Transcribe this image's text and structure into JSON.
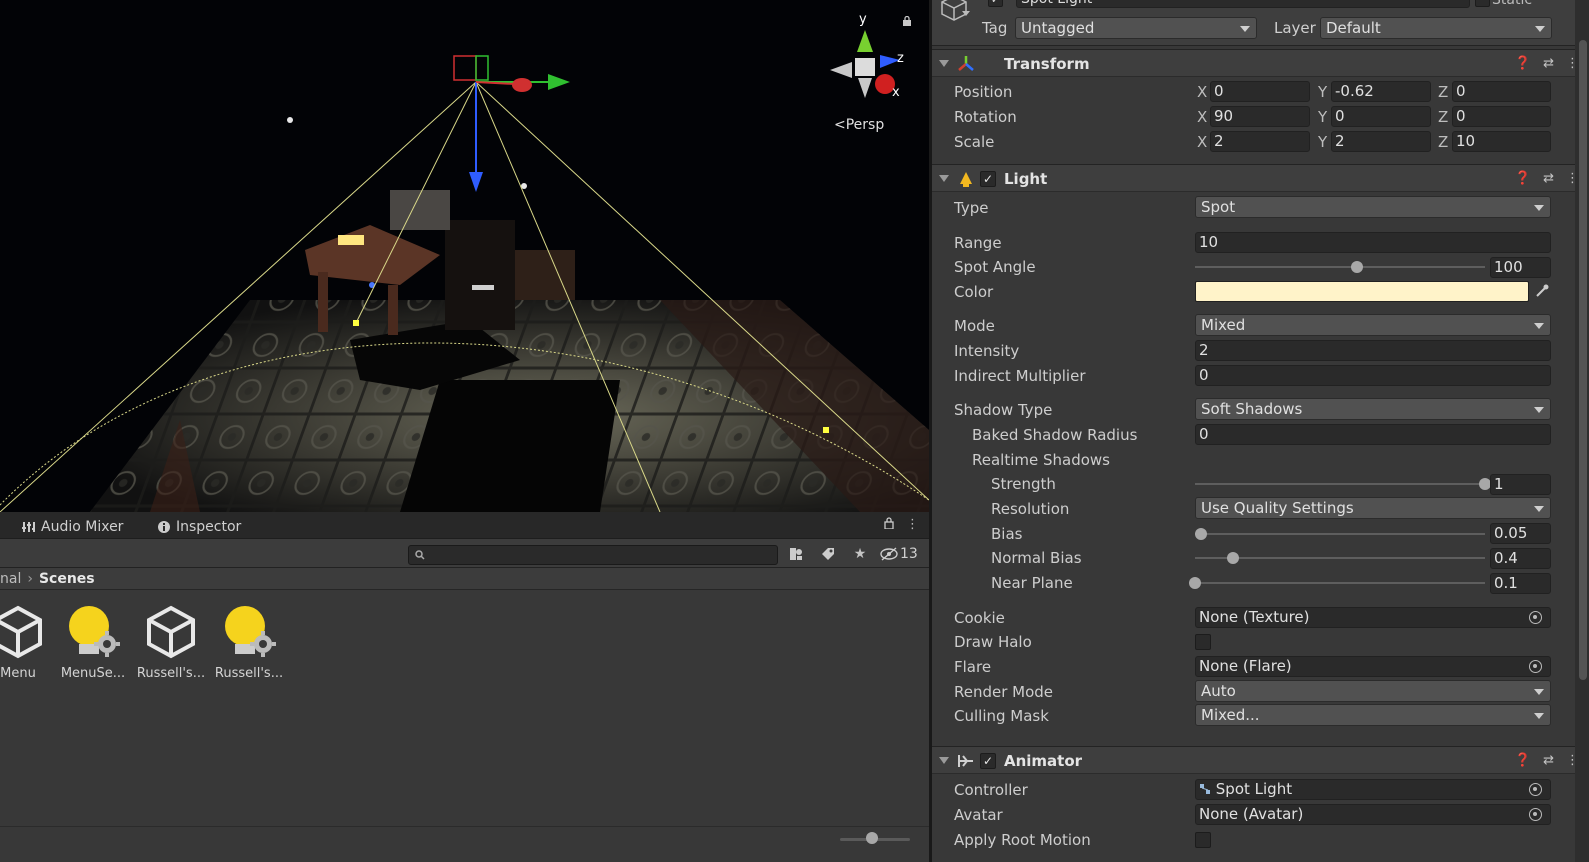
{
  "scene": {
    "gizmo_y": "y",
    "gizmo_z": "z",
    "gizmo_x": "x",
    "projection": "Persp"
  },
  "tabs": {
    "audio_mixer": "Audio Mixer",
    "inspector": "Inspector"
  },
  "project": {
    "search_placeholder": "",
    "hidden_count": "13",
    "breadcrumb_prev": "nal",
    "breadcrumb_current": "Scenes",
    "assets": [
      {
        "label": "Menu",
        "icon": "unity-scene-icon"
      },
      {
        "label": "MenuSe...",
        "icon": "lighting-settings-icon"
      },
      {
        "label": "Russell's...",
        "icon": "unity-scene-icon"
      },
      {
        "label": "Russell's...",
        "icon": "lighting-settings-icon"
      }
    ]
  },
  "inspector": {
    "object_name": "Spot Light",
    "static_label": "Static",
    "tag_label": "Tag",
    "tag_value": "Untagged",
    "layer_label": "Layer",
    "layer_value": "Default",
    "transform": {
      "title": "Transform",
      "position_label": "Position",
      "rotation_label": "Rotation",
      "scale_label": "Scale",
      "axis_x": "X",
      "axis_y": "Y",
      "axis_z": "Z",
      "position": {
        "x": "0",
        "y": "-0.62",
        "z": "0"
      },
      "rotation": {
        "x": "90",
        "y": "0",
        "z": "0"
      },
      "scale": {
        "x": "2",
        "y": "2",
        "z": "10"
      }
    },
    "light": {
      "title": "Light",
      "enabled_mark": "✓",
      "type_label": "Type",
      "type_value": "Spot",
      "range_label": "Range",
      "range_value": "10",
      "spot_angle_label": "Spot Angle",
      "spot_angle_value": "100",
      "spot_angle_fraction": 0.56,
      "color_label": "Color",
      "color_value": "#fff3c9",
      "mode_label": "Mode",
      "mode_value": "Mixed",
      "intensity_label": "Intensity",
      "intensity_value": "2",
      "indirect_label": "Indirect Multiplier",
      "indirect_value": "0",
      "shadow_type_label": "Shadow Type",
      "shadow_type_value": "Soft Shadows",
      "baked_radius_label": "Baked Shadow Radius",
      "baked_radius_value": "0",
      "realtime_label": "Realtime Shadows",
      "strength_label": "Strength",
      "strength_value": "1",
      "strength_fraction": 1.0,
      "resolution_label": "Resolution",
      "resolution_value": "Use Quality Settings",
      "bias_label": "Bias",
      "bias_value": "0.05",
      "bias_fraction": 0.02,
      "normal_bias_label": "Normal Bias",
      "normal_bias_value": "0.4",
      "normal_bias_fraction": 0.13,
      "near_plane_label": "Near Plane",
      "near_plane_value": "0.1",
      "near_plane_fraction": 0.0,
      "cookie_label": "Cookie",
      "cookie_value": "None (Texture)",
      "draw_halo_label": "Draw Halo",
      "flare_label": "Flare",
      "flare_value": "None (Flare)",
      "render_mode_label": "Render Mode",
      "render_mode_value": "Auto",
      "culling_label": "Culling Mask",
      "culling_value": "Mixed..."
    },
    "animator": {
      "title": "Animator",
      "enabled_mark": "✓",
      "controller_label": "Controller",
      "controller_value": "Spot Light",
      "avatar_label": "Avatar",
      "avatar_value": "None (Avatar)",
      "root_motion_label": "Apply Root Motion"
    }
  }
}
